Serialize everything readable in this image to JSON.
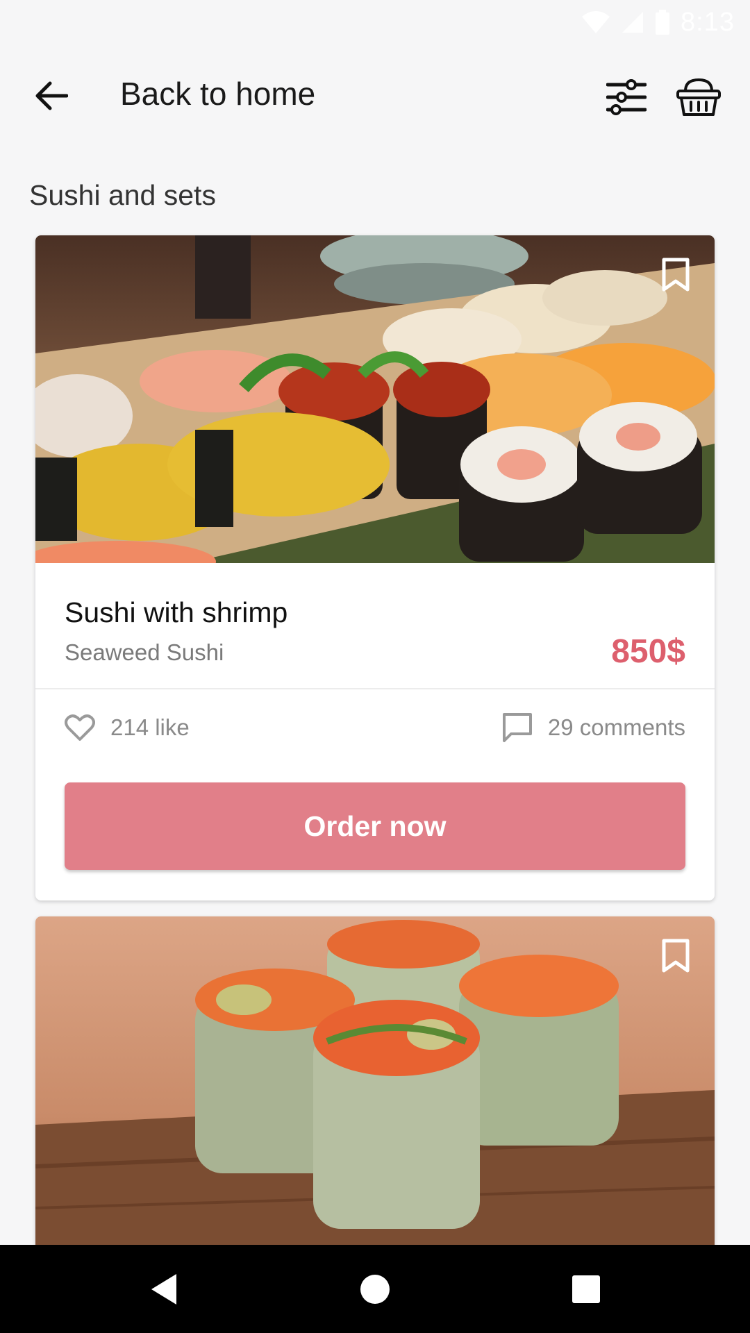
{
  "status_bar": {
    "time": "8:13"
  },
  "header": {
    "title": "Back to home"
  },
  "section": {
    "title": "Sushi and sets"
  },
  "cards": [
    {
      "name": "Sushi with shrimp",
      "category": "Seaweed Sushi",
      "price": "850$",
      "likes": "214 like",
      "comments": "29 comments",
      "order_label": "Order now"
    }
  ],
  "colors": {
    "accent": "#e17f89",
    "price": "#dd5f6d",
    "background": "#f6f6f7"
  },
  "icons": {
    "back": "arrow-left-icon",
    "filter": "sliders-icon",
    "basket": "basket-icon",
    "bookmark": "bookmark-icon",
    "like": "heart-icon",
    "comment": "comment-icon",
    "nav_back": "triangle-back-icon",
    "nav_home": "circle-home-icon",
    "nav_recents": "square-recents-icon"
  }
}
